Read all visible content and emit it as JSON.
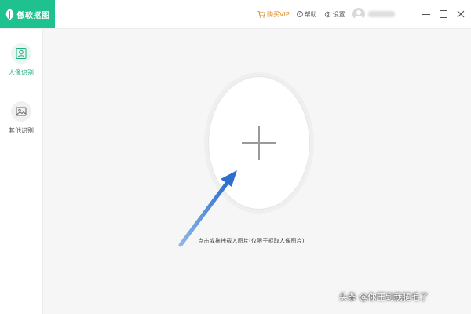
{
  "app": {
    "name": "傲软抠图",
    "brand_color": "#1fc28f"
  },
  "header": {
    "vip_label": "购买VIP",
    "help_label": "帮助",
    "settings_label": "设置"
  },
  "sidebar": {
    "items": [
      {
        "label": "人像识别",
        "icon": "portrait-icon",
        "active": true
      },
      {
        "label": "其他识别",
        "icon": "image-icon",
        "active": false
      }
    ]
  },
  "main": {
    "upload_hint": "点击或拖拽载入图片(仅限于抠取人像图片)"
  },
  "watermark": "头条 @你压到我腿毛了"
}
